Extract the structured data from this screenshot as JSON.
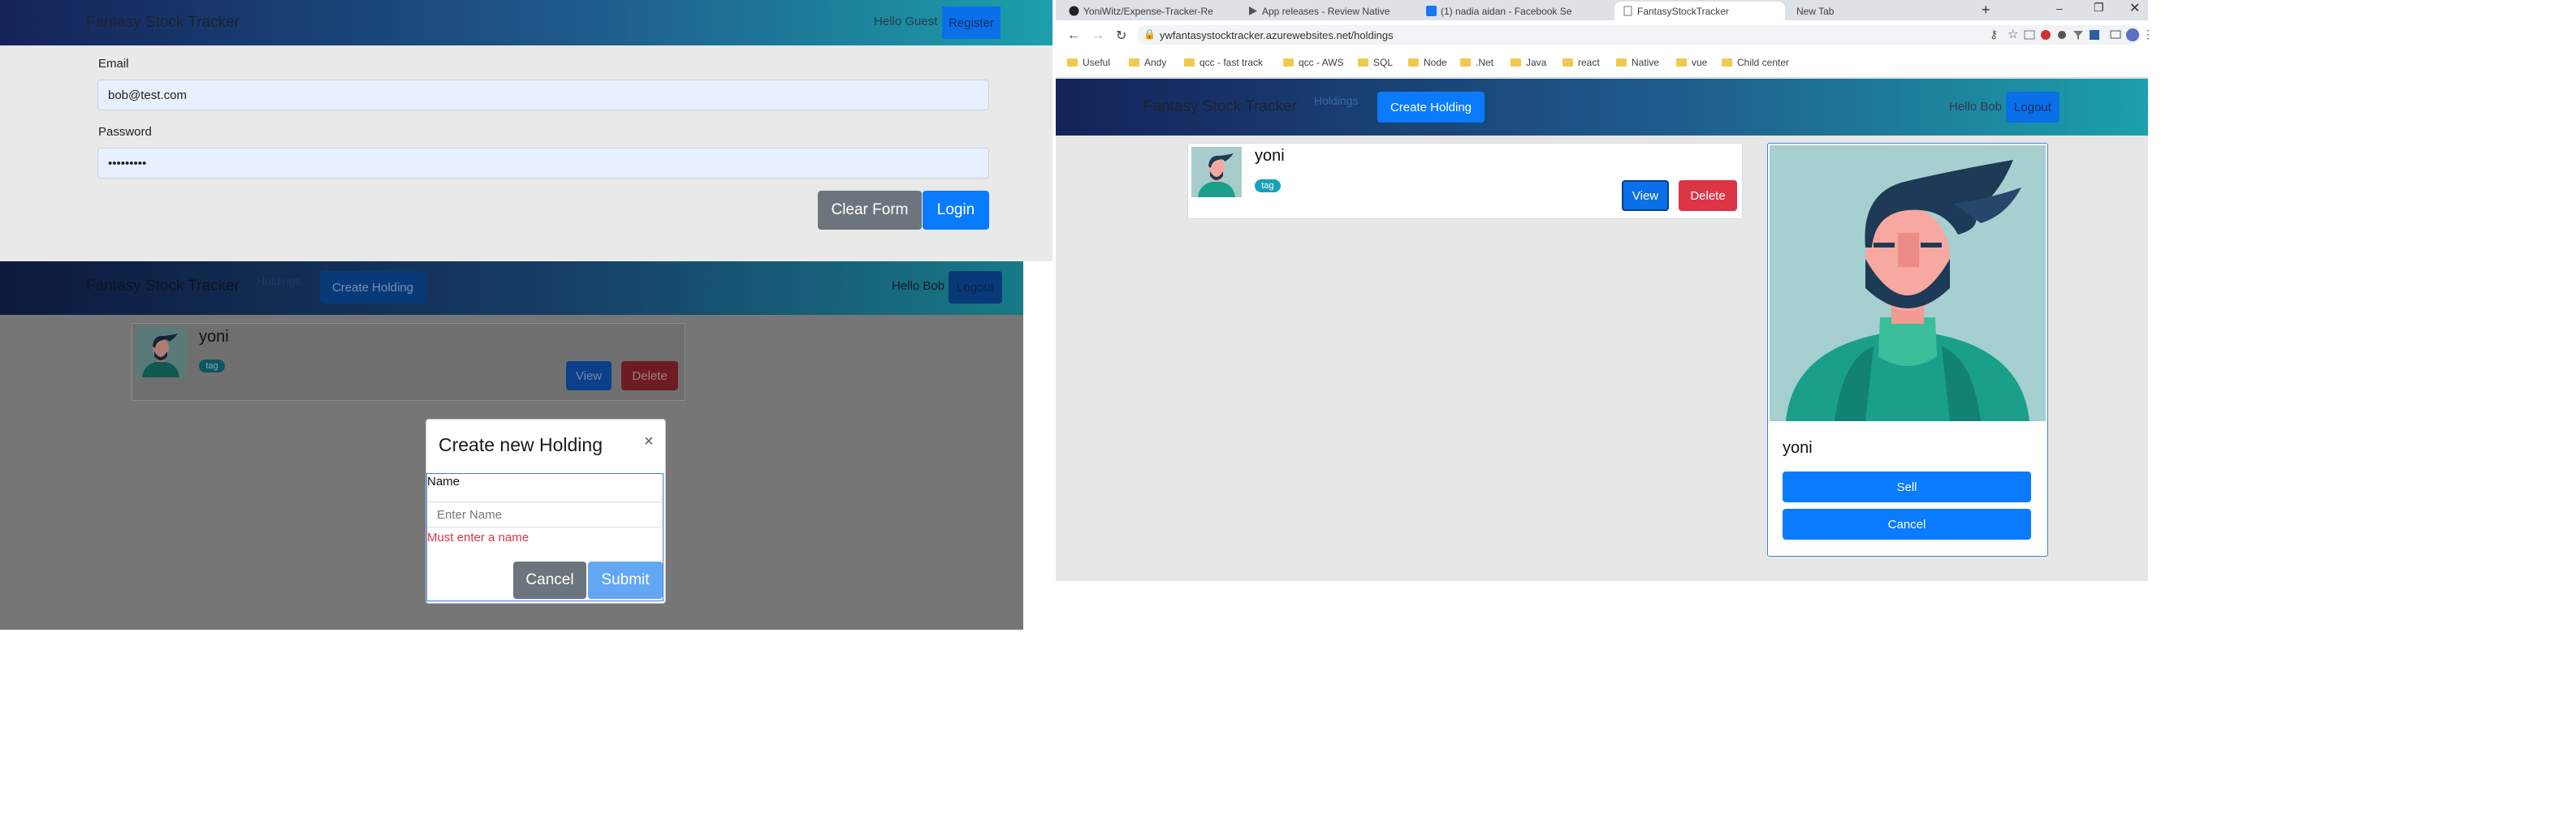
{
  "login": {
    "brand": "Fantasy Stock Tracker",
    "greeting": "Hello Guest",
    "register_label": "Register",
    "email_label": "Email",
    "email_value": "bob@test.com",
    "password_label": "Password",
    "password_value": "•••••••••",
    "clear_label": "Clear Form",
    "login_label": "Login"
  },
  "modal_view": {
    "brand": "Fantasy Stock Tracker",
    "nav_link": "Holdings",
    "create_label": "Create Holding",
    "greeting": "Hello Bob",
    "logout_label": "Logout",
    "card_name": "yoni",
    "card_tag": "tag",
    "view_label": "View",
    "delete_label": "Delete",
    "modal": {
      "title": "Create new Holding",
      "close_symbol": "×",
      "name_label": "Name",
      "name_placeholder": "Enter Name",
      "error": "Must enter a name",
      "cancel_label": "Cancel",
      "submit_label": "Submit"
    }
  },
  "browser": {
    "tabs": [
      {
        "label": "YoniWitz/Expense-Tracker-Re"
      },
      {
        "label": "App releases - Review Native"
      },
      {
        "label": "(1) nadia aidan - Facebook Se"
      },
      {
        "label": "FantasyStockTracker"
      },
      {
        "label": "New Tab"
      }
    ],
    "new_tab_symbol": "+",
    "url": "ywfantasystocktracker.azurewebsites.net/holdings",
    "bookmarks": [
      "Useful",
      "Andy",
      "qcc - fast track",
      "qcc - AWS",
      "SQL",
      "Node",
      ".Net",
      "Java",
      "react",
      "Native",
      "vue",
      "Child center"
    ],
    "app": {
      "brand": "Fantasy Stock Tracker",
      "nav_link": "Holdings",
      "create_label": "Create Holding",
      "greeting": "Hello Bob",
      "logout_label": "Logout",
      "card_name": "yoni",
      "card_tag": "tag",
      "view_label": "View",
      "delete_label": "Delete",
      "detail": {
        "name": "yoni",
        "sell_label": "Sell",
        "cancel_label": "Cancel"
      }
    }
  },
  "colors": {
    "primary": "#0a7bff",
    "danger": "#dc3545",
    "secondary": "#6c757d",
    "info": "#17a2b8",
    "error_text": "#dc3545"
  }
}
